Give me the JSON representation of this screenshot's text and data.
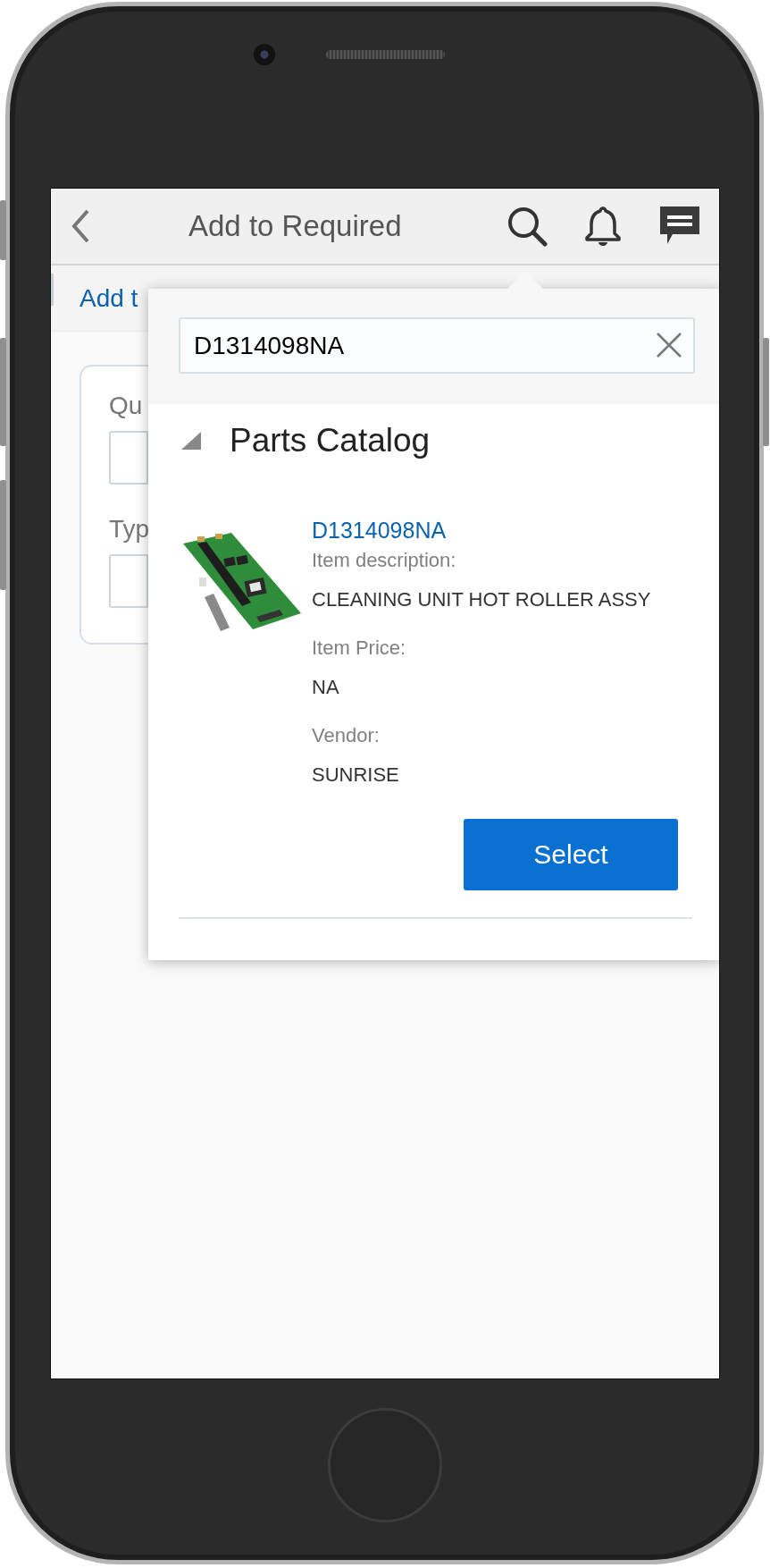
{
  "header": {
    "title": "Add to Required"
  },
  "tabs": [
    {
      "label": "Add t"
    }
  ],
  "form": {
    "fields": [
      {
        "label": "Qu"
      },
      {
        "label": "Typ"
      }
    ]
  },
  "popover": {
    "search": {
      "value": "D1314098NA"
    },
    "section": {
      "title": "Parts Catalog",
      "expanded": true
    },
    "results": [
      {
        "kind": "picture",
        "part_number": "D1314098NA",
        "details": [
          {
            "label": "Item description:",
            "value": "CLEANING UNIT HOT ROLLER ASSY"
          },
          {
            "label": "Item Price:",
            "value": "NA"
          },
          {
            "label": "Vendor:",
            "value": "SUNRISE"
          }
        ],
        "action": "Select"
      }
    ]
  }
}
